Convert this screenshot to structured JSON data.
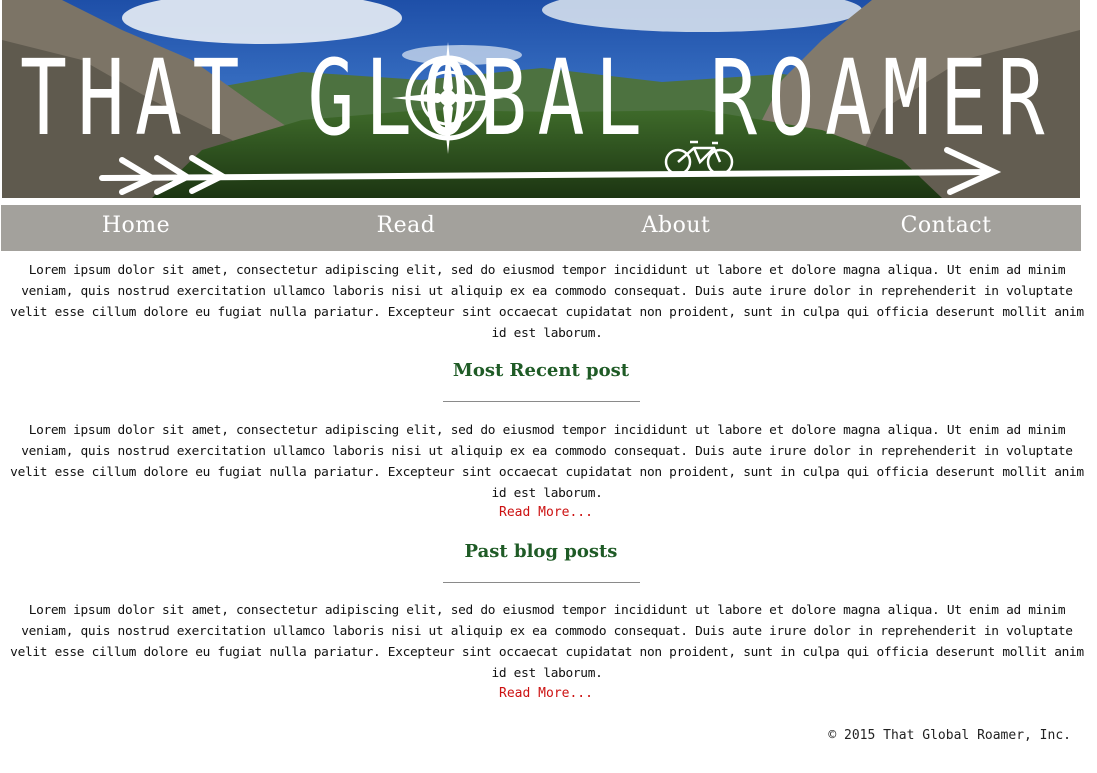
{
  "banner": {
    "title": "THAT GLOBAL ROAMER"
  },
  "nav": {
    "items": [
      {
        "label": "Home"
      },
      {
        "label": "Read"
      },
      {
        "label": "About"
      },
      {
        "label": "Contact"
      }
    ]
  },
  "intro": {
    "text": "Lorem ipsum dolor sit amet, consectetur adipiscing elit, sed do eiusmod tempor incididunt ut labore et dolore magna aliqua. Ut enim ad minim veniam, quis nostrud exercitation ullamco laboris nisi ut aliquip ex ea commodo consequat. Duis aute irure dolor in reprehenderit in voluptate velit esse cillum dolore eu fugiat nulla pariatur. Excepteur sint occaecat cupidatat non proident, sunt in culpa qui officia deserunt mollit anim id est laborum."
  },
  "recent": {
    "heading": "Most Recent post",
    "text": "Lorem ipsum dolor sit amet, consectetur adipiscing elit, sed do eiusmod tempor incididunt ut labore et dolore magna aliqua. Ut enim ad minim veniam, quis nostrud exercitation ullamco laboris nisi ut aliquip ex ea commodo consequat. Duis aute irure dolor in reprehenderit in voluptate velit esse cillum dolore eu fugiat nulla pariatur. Excepteur sint occaecat cupidatat non proident, sunt in culpa qui officia deserunt mollit anim id est laborum.",
    "read_more": "Read More..."
  },
  "past": {
    "heading": "Past blog posts",
    "text": "Lorem ipsum dolor sit amet, consectetur adipiscing elit, sed do eiusmod tempor incididunt ut labore et dolore magna aliqua. Ut enim ad minim veniam, quis nostrud exercitation ullamco laboris nisi ut aliquip ex ea commodo consequat. Duis aute irure dolor in reprehenderit in voluptate velit esse cillum dolore eu fugiat nulla pariatur. Excepteur sint occaecat cupidatat non proident, sunt in culpa qui officia deserunt mollit anim id est laborum.",
    "read_more": "Read More..."
  },
  "footer": {
    "text": "© 2015 That Global Roamer, Inc."
  },
  "colors": {
    "nav_bg": "#a3a19c",
    "heading": "#1f5b26",
    "link": "#cc1111"
  }
}
